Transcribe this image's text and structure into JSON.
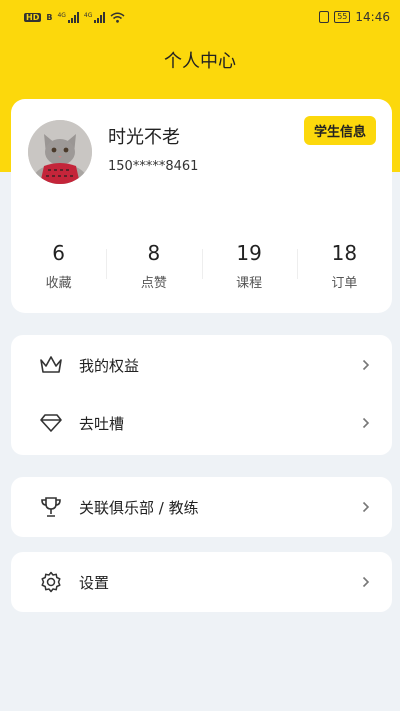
{
  "status_bar": {
    "carrier_tag": "HD",
    "carrier_tag2": "B",
    "net1": "4G",
    "net2": "4G",
    "battery": "55",
    "time": "14:46"
  },
  "page": {
    "title": "个人中心"
  },
  "profile": {
    "name": "时光不老",
    "phone": "150*****8461",
    "student_info_label": "学生信息"
  },
  "stats": [
    {
      "value": "6",
      "label": "收藏"
    },
    {
      "value": "8",
      "label": "点赞"
    },
    {
      "value": "19",
      "label": "课程"
    },
    {
      "value": "18",
      "label": "订单"
    }
  ],
  "menu": {
    "rights": "我的权益",
    "feedback": "去吐槽",
    "club": "关联俱乐部 / 教练",
    "settings": "设置"
  },
  "colors": {
    "accent": "#fcd80c",
    "background": "#eef2f6"
  }
}
